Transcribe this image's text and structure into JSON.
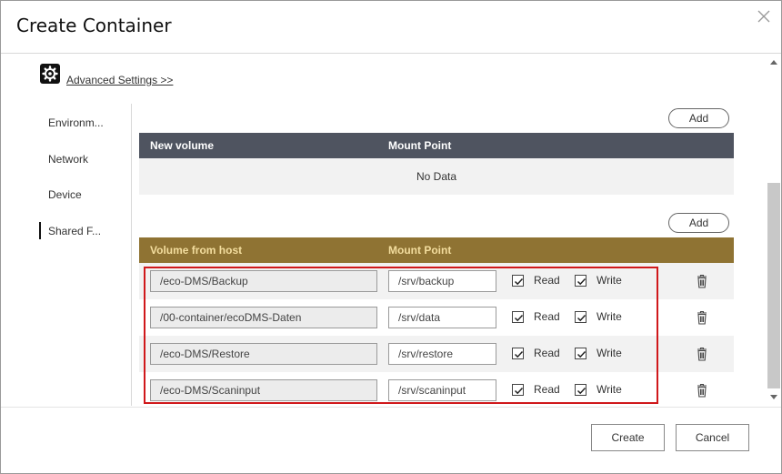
{
  "dialog": {
    "title": "Create Container",
    "close_icon": "close-icon"
  },
  "advanced": {
    "icon": "gear-icon",
    "link_label": "Advanced Settings >>"
  },
  "nav": {
    "items": [
      {
        "label": "Environm..."
      },
      {
        "label": "Network"
      },
      {
        "label": "Device"
      },
      {
        "label": "Shared F..."
      }
    ],
    "active": "Shared F..."
  },
  "new_volume_table": {
    "add_label": "Add",
    "headers": [
      "New volume",
      "Mount Point"
    ],
    "empty_text": "No Data",
    "header_color": "#4f5460"
  },
  "host_volume_table": {
    "add_label": "Add",
    "headers": [
      "Volume from host",
      "Mount Point"
    ],
    "header_color": "#8f7333",
    "rows": [
      {
        "host": "/eco-DMS/Backup",
        "mount": "/srv/backup",
        "read_label": "Read",
        "write_label": "Write",
        "read": true,
        "write": true
      },
      {
        "host": "/00-container/ecoDMS-Daten",
        "mount": "/srv/data",
        "read_label": "Read",
        "write_label": "Write",
        "read": true,
        "write": true
      },
      {
        "host": "/eco-DMS/Restore",
        "mount": "/srv/restore",
        "read_label": "Read",
        "write_label": "Write",
        "read": true,
        "write": true
      },
      {
        "host": "/eco-DMS/Scaninput",
        "mount": "/srv/scaninput",
        "read_label": "Read",
        "write_label": "Write",
        "read": true,
        "write": true
      }
    ]
  },
  "highlight_color": "#d0181b",
  "footer": {
    "create_label": "Create",
    "cancel_label": "Cancel"
  }
}
